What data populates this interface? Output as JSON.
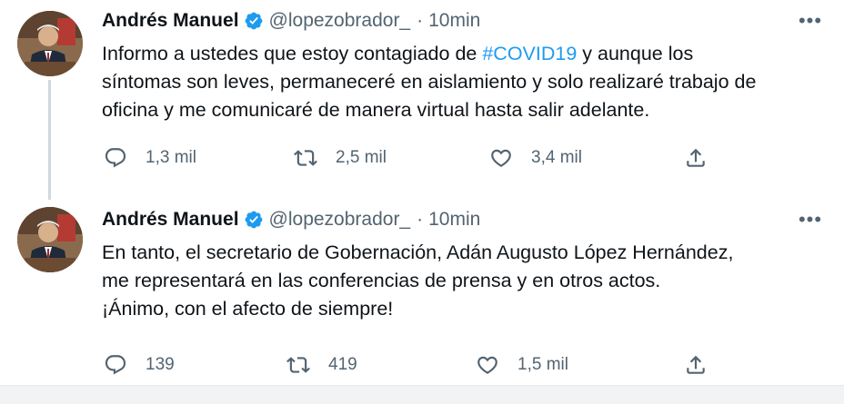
{
  "tweets": [
    {
      "author": "Andrés Manuel",
      "handle": "@lopezobrador_",
      "separator": "·",
      "time": "10min",
      "more": "•••",
      "lines": [
        {
          "before": "Informo a ustedes que estoy contagiado de ",
          "hashtag": "#COVID19",
          "after": " y aunque los"
        },
        {
          "text": "síntomas son leves, permaneceré en aislamiento y solo realizaré trabajo de"
        },
        {
          "text": "oficina y me comunicaré de manera virtual hasta salir adelante."
        }
      ],
      "replies": "1,3 mil",
      "retweets": "2,5 mil",
      "likes": "3,4 mil"
    },
    {
      "author": "Andrés Manuel",
      "handle": "@lopezobrador_",
      "separator": "·",
      "time": "10min",
      "more": "•••",
      "lines": [
        {
          "text": "En tanto, el secretario de Gobernación, Adán Augusto López Hernández,"
        },
        {
          "text": "me representará en las conferencias de prensa y en otros actos."
        },
        {
          "text": "¡Ánimo, con el afecto de siempre!"
        }
      ],
      "replies": "139",
      "retweets": "419",
      "likes": "1,5 mil"
    }
  ],
  "icons": {
    "verified": "verified-badge-icon",
    "reply": "reply-bubble-icon",
    "retweet": "retweet-arrows-icon",
    "like": "heart-icon",
    "share": "share-upload-icon",
    "more": "more-dots-icon"
  },
  "colors": {
    "text": "#0f1419",
    "secondary": "#536471",
    "hashtag": "#1d9bf0",
    "verified": "#1d9bf0",
    "thread_line": "#cfd9de"
  }
}
